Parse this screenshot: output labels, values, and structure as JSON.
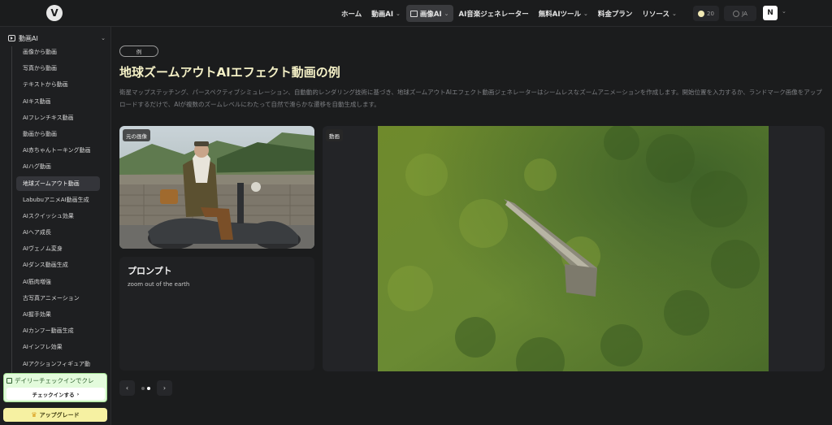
{
  "header": {
    "logo_text": "V",
    "nav": [
      {
        "label": "ホーム",
        "has_dropdown": false
      },
      {
        "label": "動画AI",
        "has_dropdown": true
      },
      {
        "label": "画像AI",
        "has_dropdown": true,
        "active": true
      },
      {
        "label": "AI音楽ジェネレーター",
        "has_dropdown": false
      },
      {
        "label": "無料AIツール",
        "has_dropdown": true
      },
      {
        "label": "料金プラン",
        "has_dropdown": false
      },
      {
        "label": "リソース",
        "has_dropdown": true
      }
    ],
    "credits": "20",
    "language": "JA",
    "avatar_initial": "N"
  },
  "sidebar": {
    "section_title": "動画AI",
    "items": [
      {
        "label": "画像から動画"
      },
      {
        "label": "写真から動画"
      },
      {
        "label": "テキストから動画"
      },
      {
        "label": "AIキス動画"
      },
      {
        "label": "AIフレンチキス動画"
      },
      {
        "label": "動画から動画"
      },
      {
        "label": "AI赤ちゃんトーキング動画"
      },
      {
        "label": "AIハグ動画"
      },
      {
        "label": "地球ズームアウト動画",
        "active": true
      },
      {
        "label": "LabubuアニメAI動画生成"
      },
      {
        "label": "AIスクイッシュ効果"
      },
      {
        "label": "AIヘア成長"
      },
      {
        "label": "AIヴェノム変身"
      },
      {
        "label": "AIダンス動画生成"
      },
      {
        "label": "AI筋肉増強"
      },
      {
        "label": "古写真アニメーション"
      },
      {
        "label": "AI握手効果"
      },
      {
        "label": "AIカンフー動画生成"
      },
      {
        "label": "AIインフレ効果"
      },
      {
        "label": "AIアクションフィギュア動"
      }
    ],
    "checkin_title": "デイリーチェックインでクレ",
    "checkin_button": "チェックインする",
    "upgrade_button": "アップグレード"
  },
  "main": {
    "badge": "例",
    "title": "地球ズームアウトAIエフェクト動画の例",
    "description": "衛星マップステッチング、パースペクティブシミュレーション、自動動的レンダリング技術に基づき、地球ズームアウトAIエフェクト動画ジェネレーターはシームレスなズームアニメーションを作成します。開始位置を入力するか、ランドマーク画像をアップロードするだけで、AIが複数のズームレベルにわたって自然で滑らかな遷移を自動生成します。",
    "original_image_label": "元の画像",
    "prompt_heading": "プロンプト",
    "prompt_text": "zoom out of the earth",
    "video_label": "動画",
    "pager": {
      "prev": "‹",
      "next": "›",
      "pages": 2,
      "current": 2
    }
  }
}
